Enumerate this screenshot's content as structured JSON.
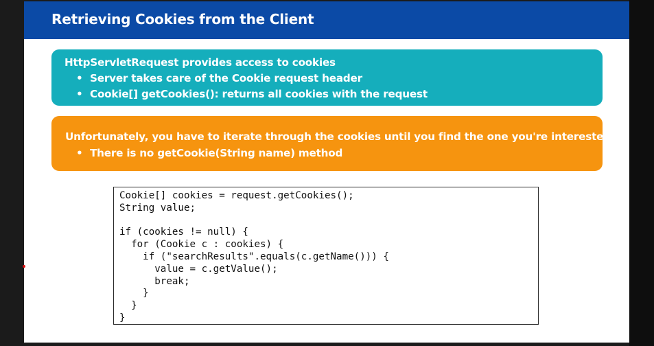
{
  "slide": {
    "title": "Retrieving Cookies from the Client",
    "teal_box": {
      "heading": "HttpServletRequest provides access to cookies",
      "bullets": [
        "Server takes care of the Cookie request header",
        "Cookie[] getCookies(): returns all cookies with the request"
      ]
    },
    "orange_box": {
      "heading": "Unfortunately, you have to iterate through the cookies until you find the one you're interested in",
      "bullets": [
        "There is no getCookie(String name) method"
      ]
    },
    "code_lines": [
      "Cookie[] cookies = request.getCookies();",
      "String value;",
      "",
      "if (cookies != null) {",
      "  for (Cookie c : cookies) {",
      "    if (\"searchResults\".equals(c.getName())) {",
      "      value = c.getValue();",
      "      break;",
      "    }",
      "  }",
      "}"
    ]
  },
  "colors": {
    "header": "#0b4aa6",
    "teal": "#15aebc",
    "orange": "#f6940f"
  }
}
